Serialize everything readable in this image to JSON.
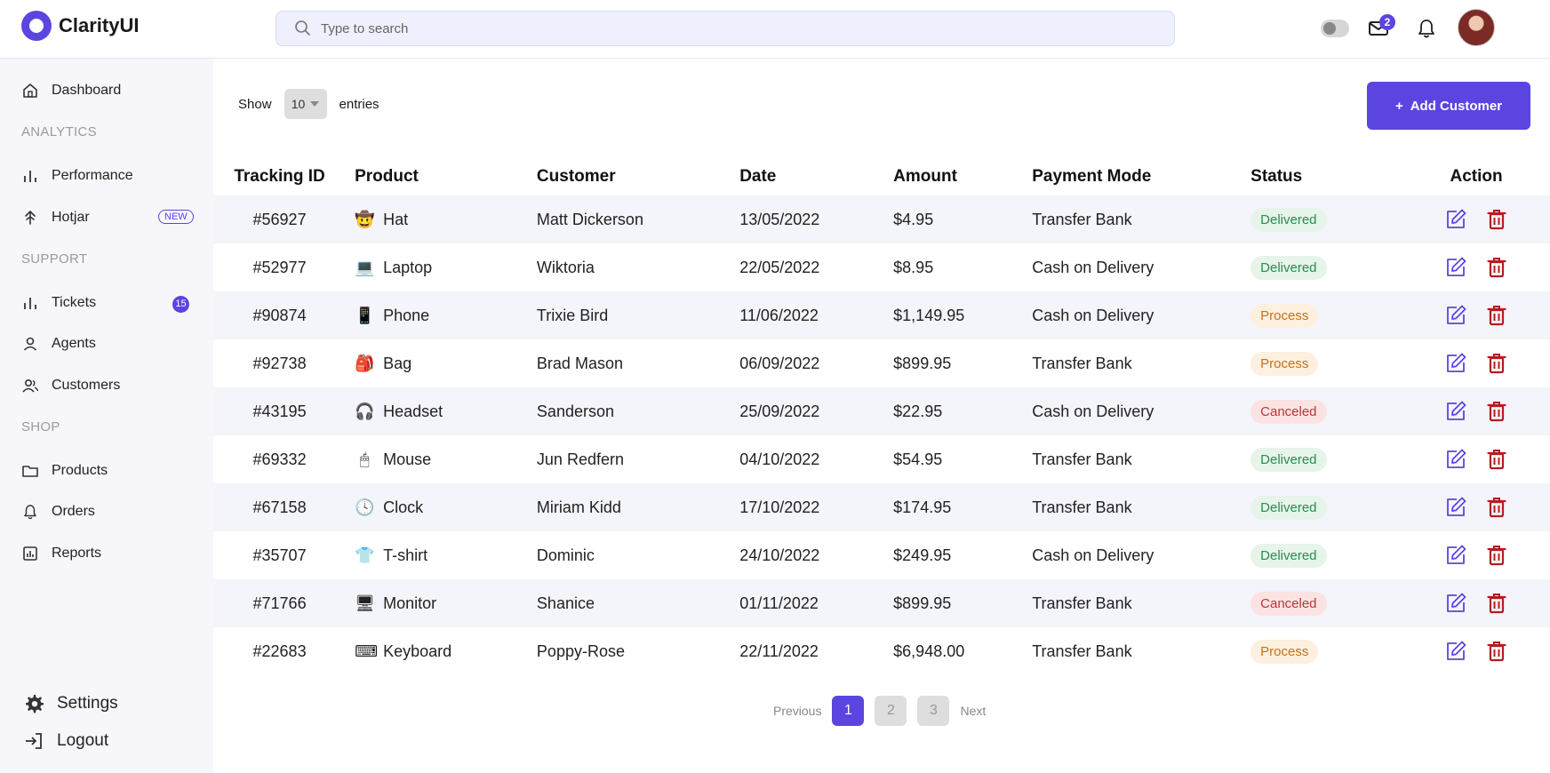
{
  "app": {
    "brand": "ClarityUI"
  },
  "search": {
    "placeholder": "Type to search"
  },
  "header": {
    "mail_count": "2"
  },
  "sidebar": {
    "dashboard": "Dashboard",
    "analytics_title": "ANALYTICS",
    "performance": "Performance",
    "hotjar": "Hotjar",
    "hotjar_badge": "NEW",
    "support_title": "SUPPORT",
    "tickets": "Tickets",
    "tickets_count": "15",
    "agents": "Agents",
    "customers": "Customers",
    "shop_title": "SHOP",
    "products": "Products",
    "orders": "Orders",
    "reports": "Reports",
    "settings": "Settings",
    "logout": "Logout"
  },
  "toolbar": {
    "show_label": "Show",
    "entries_value": "10",
    "entries_label": "entries",
    "add_customer": "Add Customer"
  },
  "table": {
    "columns": [
      "Tracking ID",
      "Product",
      "Customer",
      "Date",
      "Amount",
      "Payment Mode",
      "Status",
      "Action"
    ],
    "rows": [
      {
        "id": "#56927",
        "product": "Hat",
        "icon": "hat-icon",
        "glyph": "🤠",
        "customer": "Matt Dickerson",
        "date": "13/05/2022",
        "amount": "$4.95",
        "payment": "Transfer Bank",
        "status": "Delivered"
      },
      {
        "id": "#52977",
        "product": "Laptop",
        "icon": "laptop-icon",
        "glyph": "💻",
        "customer": "Wiktoria",
        "date": "22/05/2022",
        "amount": "$8.95",
        "payment": "Cash on Delivery",
        "status": "Delivered"
      },
      {
        "id": "#90874",
        "product": "Phone",
        "icon": "phone-icon",
        "glyph": "📱",
        "customer": "Trixie Bird",
        "date": "11/06/2022",
        "amount": "$1,149.95",
        "payment": "Cash on Delivery",
        "status": "Process"
      },
      {
        "id": "#92738",
        "product": "Bag",
        "icon": "bag-icon",
        "glyph": "🎒",
        "customer": "Brad Mason",
        "date": "06/09/2022",
        "amount": "$899.95",
        "payment": "Transfer Bank",
        "status": "Process"
      },
      {
        "id": "#43195",
        "product": "Headset",
        "icon": "headset-icon",
        "glyph": "🎧",
        "customer": "Sanderson",
        "date": "25/09/2022",
        "amount": "$22.95",
        "payment": "Cash on Delivery",
        "status": "Canceled"
      },
      {
        "id": "#69332",
        "product": "Mouse",
        "icon": "mouse-icon",
        "glyph": "🖱",
        "customer": "Jun Redfern",
        "date": "04/10/2022",
        "amount": "$54.95",
        "payment": "Transfer Bank",
        "status": "Delivered"
      },
      {
        "id": "#67158",
        "product": "Clock",
        "icon": "clock-icon",
        "glyph": "🕓",
        "customer": "Miriam Kidd",
        "date": "17/10/2022",
        "amount": "$174.95",
        "payment": "Transfer Bank",
        "status": "Delivered"
      },
      {
        "id": "#35707",
        "product": "T-shirt",
        "icon": "tshirt-icon",
        "glyph": "👕",
        "customer": "Dominic",
        "date": "24/10/2022",
        "amount": "$249.95",
        "payment": "Cash on Delivery",
        "status": "Delivered"
      },
      {
        "id": "#71766",
        "product": "Monitor",
        "icon": "monitor-icon",
        "glyph": "🖥",
        "customer": "Shanice",
        "date": "01/11/2022",
        "amount": "$899.95",
        "payment": "Transfer Bank",
        "status": "Canceled"
      },
      {
        "id": "#22683",
        "product": "Keyboard",
        "icon": "keyboard-icon",
        "glyph": "⌨",
        "customer": "Poppy-Rose",
        "date": "22/11/2022",
        "amount": "$6,948.00",
        "payment": "Transfer Bank",
        "status": "Process"
      }
    ]
  },
  "pagination": {
    "previous": "Previous",
    "next": "Next",
    "pages": [
      "1",
      "2",
      "3"
    ],
    "current": "1"
  },
  "colors": {
    "accent": "#5b45e0",
    "delivered": "#2e8a4e",
    "process": "#c0731f",
    "canceled": "#b53838",
    "delete": "#b51c1c"
  }
}
